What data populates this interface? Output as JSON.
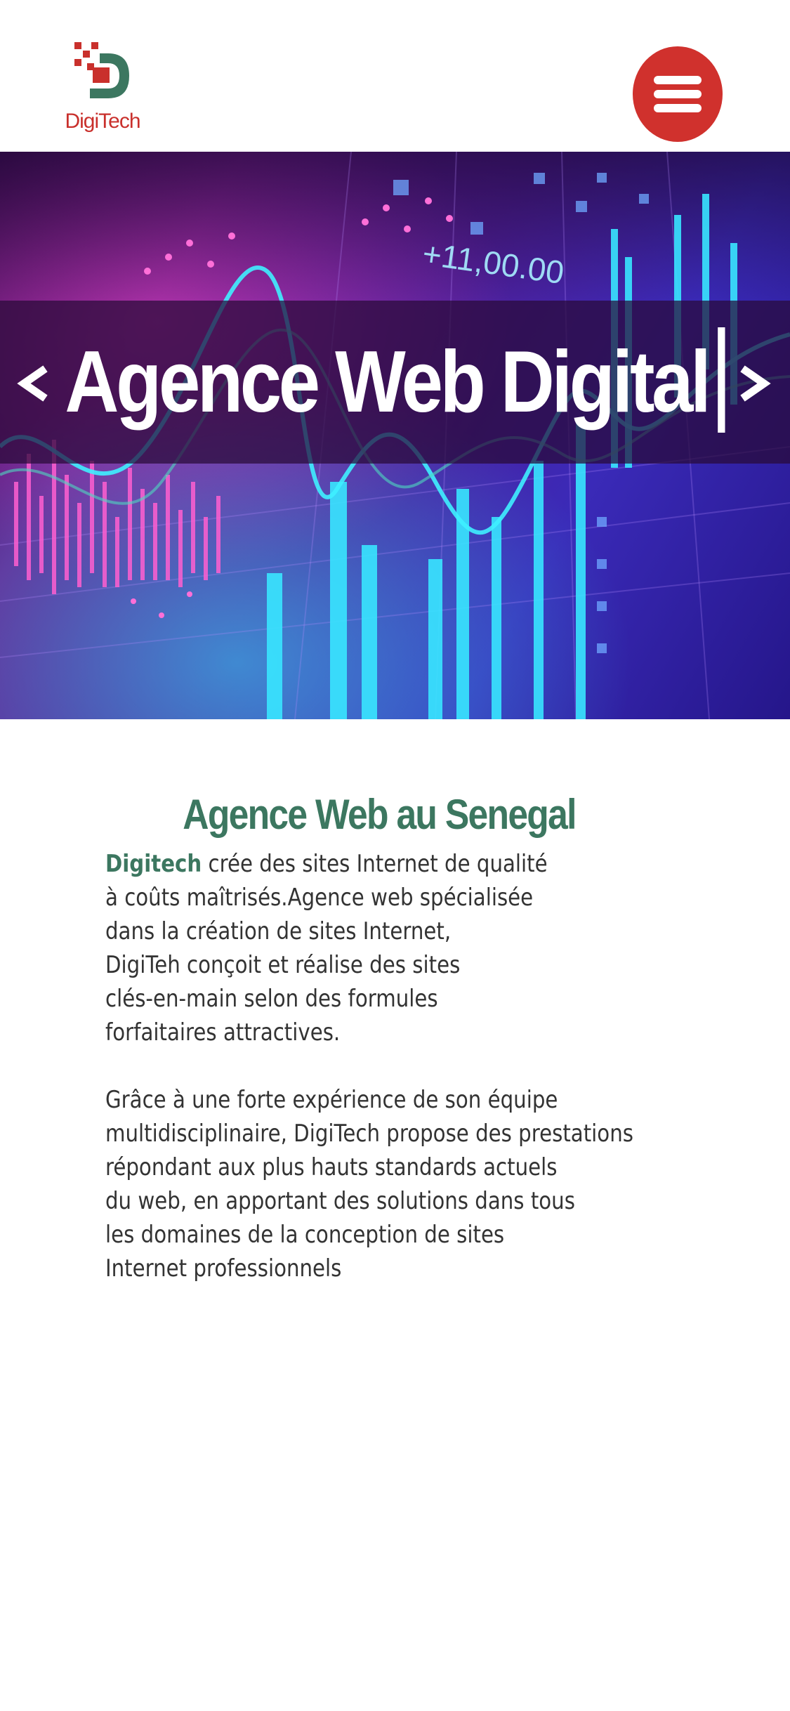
{
  "header": {
    "logo_text_part1": "Digi",
    "logo_text_part2": "Tech",
    "menu_icon": "hamburger-icon"
  },
  "hero": {
    "title": "Agence Web Digital",
    "background_text": "+11,00.00",
    "prev_icon": "chevron-left-icon",
    "next_icon": "chevron-right-icon"
  },
  "main": {
    "title": "Agence Web au Senegal",
    "intro_brand": "Digitech",
    "intro_text": " crée des sites Internet de qualité\nà coûts maîtrisés.Agence web spécialisée\ndans la création de sites Internet,\nDigiTeh conçoit et réalise des sites\nclés-en-main selon des formules\nforfaitaires attractives.",
    "second_paragraph": "Grâce à une forte expérience de son équipe\nmultidisciplinaire, DigiTech propose des prestations\nrépondant aux plus hauts standards actuels\ndu web, en apportant des solutions dans tous\nles domaines de la conception de sites\nInternet professionnels"
  },
  "colors": {
    "brand_red": "#d0312d",
    "brand_green": "#3c7760",
    "hero_purple": "#4f1f9a"
  }
}
